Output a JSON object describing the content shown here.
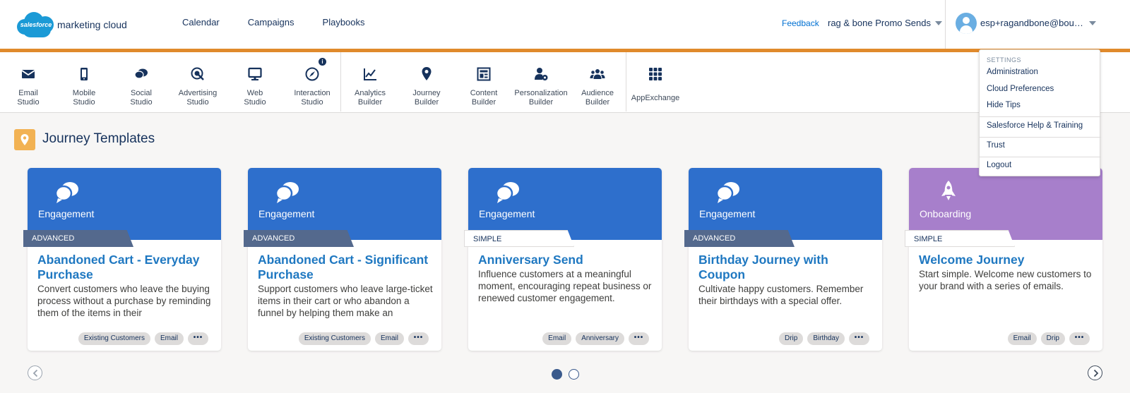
{
  "brand": {
    "logo_mark": "salesforce",
    "product": "marketing cloud"
  },
  "topnav": {
    "items": [
      {
        "label": "Calendar"
      },
      {
        "label": "Campaigns"
      },
      {
        "label": "Playbooks"
      }
    ]
  },
  "header": {
    "feedback": "Feedback",
    "business_unit": "rag & bone Promo Sends",
    "user_email": "esp+ragandbone@bounc..."
  },
  "apps": [
    {
      "line1": "Email",
      "line2": "Studio",
      "icon": "envelope-icon"
    },
    {
      "line1": "Mobile",
      "line2": "Studio",
      "icon": "mobile-icon"
    },
    {
      "line1": "Social",
      "line2": "Studio",
      "icon": "chat-icon"
    },
    {
      "line1": "Advertising",
      "line2": "Studio",
      "icon": "target-icon"
    },
    {
      "line1": "Web",
      "line2": "Studio",
      "icon": "monitor-icon"
    },
    {
      "line1": "Interaction",
      "line2": "Studio",
      "icon": "compass-icon"
    },
    {
      "line1": "Analytics",
      "line2": "Builder",
      "icon": "line-chart-icon"
    },
    {
      "line1": "Journey",
      "line2": "Builder",
      "icon": "location-pin-icon"
    },
    {
      "line1": "Content",
      "line2": "Builder",
      "icon": "layout-icon"
    },
    {
      "line1": "Personalization",
      "line2": "Builder",
      "icon": "person-gear-icon"
    },
    {
      "line1": "Audience",
      "line2": "Builder",
      "icon": "people-icon"
    },
    {
      "line1": "AppExchange",
      "line2": "",
      "icon": "app-grid-icon"
    }
  ],
  "interaction_badge": "i",
  "page": {
    "title": "Journey Templates"
  },
  "cards": [
    {
      "category": "Engagement",
      "level": "ADVANCED",
      "title": "Abandoned Cart - Everyday Purchase",
      "desc": "Convert customers who leave the buying process without a purchase by reminding them of the items in their",
      "tags": [
        "Existing Customers",
        "Email"
      ],
      "more": "•••"
    },
    {
      "category": "Engagement",
      "level": "ADVANCED",
      "title": "Abandoned Cart - Significant Purchase",
      "desc": "Support customers who leave large-ticket items in their cart or who abandon a funnel by helping them make an",
      "tags": [
        "Existing Customers",
        "Email"
      ],
      "more": "•••"
    },
    {
      "category": "Engagement",
      "level": "SIMPLE",
      "title": "Anniversary Send",
      "desc": "Influence customers at a meaningful moment, encouraging repeat business or renewed customer engagement.",
      "tags": [
        "Email",
        "Anniversary"
      ],
      "more": "•••"
    },
    {
      "category": "Engagement",
      "level": "ADVANCED",
      "title": "Birthday Journey with Coupon",
      "desc": "Cultivate happy customers. Remember their birthdays with a special offer.",
      "tags": [
        "Drip",
        "Birthday"
      ],
      "more": "•••"
    },
    {
      "category": "Onboarding",
      "level": "SIMPLE",
      "title": "Welcome Journey",
      "desc": "Start simple. Welcome new customers to your brand with a series of emails.",
      "tags": [
        "Email",
        "Drip"
      ],
      "more": "•••"
    }
  ],
  "carousel": {
    "pages": 2,
    "current": 1
  },
  "dropdown": {
    "header": "SETTINGS",
    "items": [
      "Administration",
      "Cloud Preferences",
      "Hide Tips",
      "Salesforce Help & Training",
      "Trust",
      "Logout"
    ]
  },
  "colors": {
    "accent_orange": "#e08a2c",
    "engagement": "#2e6fcc",
    "onboarding": "#a77fcb",
    "title_blue": "#1f78c1"
  }
}
